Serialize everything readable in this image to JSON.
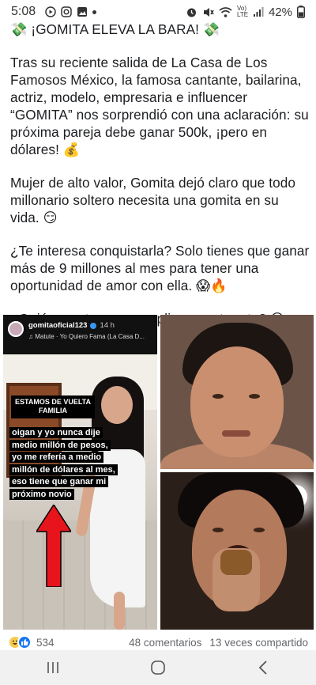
{
  "status_bar": {
    "time": "5:08",
    "network": "Vo) LTE",
    "battery": "42%",
    "left_icons": [
      "youtube-icon",
      "instagram-icon",
      "gallery-icon",
      "dot"
    ],
    "right_icons": [
      "alarm-icon",
      "mute-icon",
      "wifi-icon",
      "signal-icon",
      "battery-icon"
    ]
  },
  "post": {
    "headline": "💸 ¡GOMITA ELEVA LA BARA! 💸",
    "paragraph_1": "Tras su reciente salida de La Casa de Los Famosos México, la famosa cantante, bailarina, actriz, modelo, empresaria e influencer “GOMITA” nos sorprendió con una aclaración: su próxima pareja debe ganar 500k, ¡pero en dólares! 💰",
    "paragraph_2": "Mujer de alto valor, Gomita dejó claro que todo millonario soltero necesita una gomita en su vida. 😏",
    "paragraph_3": "¿Te interesa conquistarla? Solo tienes que ganar más de 9 millones al mes para tener una oportunidad de amor con ella. 😱🔥",
    "paragraph_4": "¿Quién se atreve a cumplir con este reto? 😉"
  },
  "story": {
    "username": "gomitaoficial123",
    "time": "14 h",
    "music": "♫ Matute · Yo Quiero Fama (La Casa D...",
    "badge_line1": "ESTAMOS DE VUELTA",
    "badge_line2": "FAMILIA",
    "caption": "oigan y yo nunca dije medio millón de pesos, yo me refería a medio millón de dólares al mes, eso tiene que ganar mi próximo novio"
  },
  "reactions": {
    "count": "534",
    "comments": "48 comentarios",
    "shares": "13 veces compartido"
  },
  "nav": {
    "recent": "recent-apps-icon",
    "home": "home-icon",
    "back": "back-icon"
  },
  "colors": {
    "text": "#1c1e21",
    "secondary": "#65676b",
    "like_blue": "#1877f2",
    "arrow_red": "#e8141c"
  }
}
